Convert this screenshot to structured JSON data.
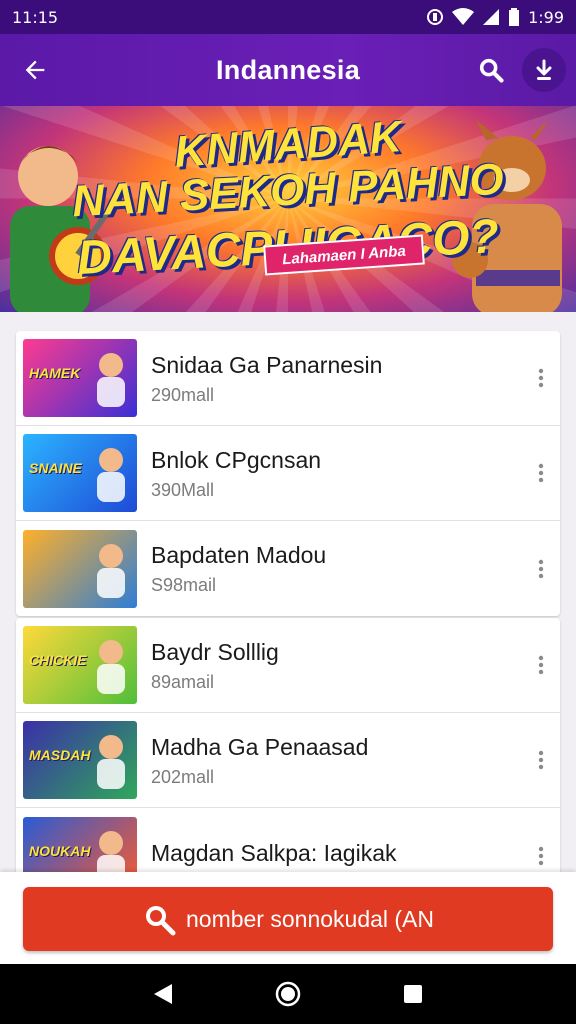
{
  "status_bar": {
    "time": "11:15",
    "clock": "1:99"
  },
  "app_bar": {
    "title": "Indannesia"
  },
  "banner": {
    "line1": "KNMADAK",
    "line2": "NAN SEKOH PAHNO",
    "line3": "DAVACPI IIGACO?",
    "tag": "Lahamaen I Anba"
  },
  "list": {
    "items": [
      {
        "title": "Snidaa Ga Panarnesin",
        "subtitle": "290mall",
        "thumb_text": "HAMEK",
        "thumb_colors": [
          "#ff3b8f",
          "#3a2fd6"
        ]
      },
      {
        "title": "Bnlok CPgcnsan",
        "subtitle": "390Mall",
        "thumb_text": "SNAINE",
        "thumb_colors": [
          "#2bb4ff",
          "#1f4ad6"
        ]
      },
      {
        "title": "Bapdaten Madou",
        "subtitle": "S98mail",
        "thumb_text": "",
        "thumb_colors": [
          "#ffb02a",
          "#2e7dd6"
        ]
      },
      {
        "title": "Baydr Solllig",
        "subtitle": "89amail",
        "thumb_text": "CHICKIE",
        "thumb_colors": [
          "#ffd93a",
          "#4fbf3a"
        ]
      },
      {
        "title": "Madha Ga Penaasad",
        "subtitle": "202mall",
        "thumb_text": "MASDAH",
        "thumb_colors": [
          "#3b2fa8",
          "#2fa85a"
        ]
      },
      {
        "title": "Magdan Salkpa: Iagikak",
        "subtitle": "",
        "thumb_text": "NOUKAH",
        "thumb_colors": [
          "#2a5bd6",
          "#ff5a2a"
        ]
      }
    ]
  },
  "cta": {
    "label": "nomber sonnokudal (AN"
  },
  "colors": {
    "app_bar": "#5b19a8",
    "status_bar": "#3a0d7a",
    "cta": "#e13a23"
  },
  "icons": [
    "back-arrow-icon",
    "search-icon",
    "download-icon",
    "more-vert-icon",
    "nav-back-icon",
    "nav-home-icon",
    "nav-recents-icon"
  ]
}
